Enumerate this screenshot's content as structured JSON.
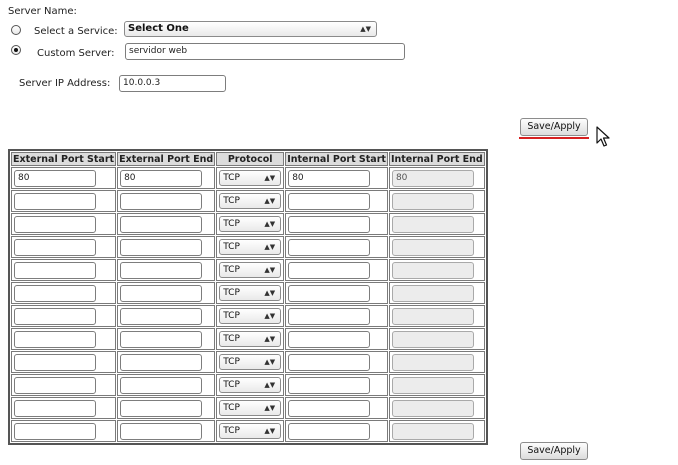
{
  "form": {
    "server_name_label": "Server Name:",
    "select_service_label": "Select a Service:",
    "custom_server_label": "Custom Server:",
    "service_select_value": "Select One",
    "custom_server_value": "servidor web",
    "server_ip_label": "Server IP Address:",
    "server_ip_value": "10.0.0.3",
    "selected_option": "custom_server"
  },
  "buttons": {
    "save_apply_top": "Save/Apply",
    "save_apply_bottom": "Save/Apply"
  },
  "table": {
    "headers": [
      "External Port Start",
      "External Port End",
      "Protocol",
      "Internal Port Start",
      "Internal Port End"
    ],
    "rows": [
      {
        "ext_start": "80",
        "ext_end": "80",
        "protocol": "TCP",
        "int_start": "80",
        "int_end": "80"
      },
      {
        "ext_start": "",
        "ext_end": "",
        "protocol": "TCP",
        "int_start": "",
        "int_end": ""
      },
      {
        "ext_start": "",
        "ext_end": "",
        "protocol": "TCP",
        "int_start": "",
        "int_end": ""
      },
      {
        "ext_start": "",
        "ext_end": "",
        "protocol": "TCP",
        "int_start": "",
        "int_end": ""
      },
      {
        "ext_start": "",
        "ext_end": "",
        "protocol": "TCP",
        "int_start": "",
        "int_end": ""
      },
      {
        "ext_start": "",
        "ext_end": "",
        "protocol": "TCP",
        "int_start": "",
        "int_end": ""
      },
      {
        "ext_start": "",
        "ext_end": "",
        "protocol": "TCP",
        "int_start": "",
        "int_end": ""
      },
      {
        "ext_start": "",
        "ext_end": "",
        "protocol": "TCP",
        "int_start": "",
        "int_end": ""
      },
      {
        "ext_start": "",
        "ext_end": "",
        "protocol": "TCP",
        "int_start": "",
        "int_end": ""
      },
      {
        "ext_start": "",
        "ext_end": "",
        "protocol": "TCP",
        "int_start": "",
        "int_end": ""
      },
      {
        "ext_start": "",
        "ext_end": "",
        "protocol": "TCP",
        "int_start": "",
        "int_end": ""
      },
      {
        "ext_start": "",
        "ext_end": "",
        "protocol": "TCP",
        "int_start": "",
        "int_end": ""
      }
    ]
  },
  "icons": {
    "cursor": "mouse-pointer-icon",
    "select_arrow": "updown-arrow-icon"
  },
  "colors": {
    "annotation_underline": "#d62020",
    "header_bg": "#dcdcdc"
  }
}
